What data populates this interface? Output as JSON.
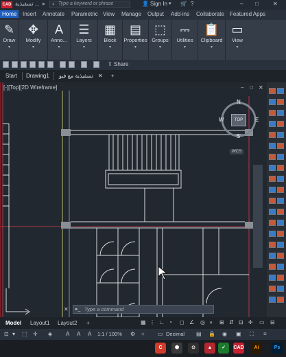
{
  "titlebar": {
    "app_logo": "CAD",
    "document_title": "تسفيذية ...",
    "search_placeholder": "Type a keyword or phrase",
    "signin_label": "Sign In",
    "window_controls": [
      "–",
      "□",
      "✕"
    ]
  },
  "menu_tabs": [
    "Home",
    "Insert",
    "Annotate",
    "Parametric",
    "View",
    "Manage",
    "Output",
    "Add-ins",
    "Collaborate",
    "Featured Apps"
  ],
  "ribbon_groups": [
    {
      "label": "Draw",
      "icon": "draw-icon"
    },
    {
      "label": "Modify",
      "icon": "modify-icon"
    },
    {
      "label": "Anno...",
      "icon": "annotation-icon"
    },
    {
      "label": "Layers",
      "icon": "layers-icon"
    },
    {
      "label": "Block",
      "icon": "block-icon"
    },
    {
      "label": "Properties",
      "icon": "properties-icon"
    },
    {
      "label": "Groups",
      "icon": "groups-icon"
    },
    {
      "label": "Utilities",
      "icon": "utilities-icon"
    },
    {
      "label": "Clipboard",
      "icon": "clipboard-icon"
    },
    {
      "label": "View",
      "icon": "view-icon"
    }
  ],
  "quick_access": {
    "share_label": "Share"
  },
  "file_tabs": {
    "start": "Start",
    "drawing1": "Drawing1",
    "active_doc": "تسفيذية مع فيو",
    "add": "+"
  },
  "viewport": {
    "label": "[-][Top][2D Wireframe]",
    "viewcube": {
      "top": "TOP",
      "north": "N",
      "south": "S",
      "east": "E",
      "west": "W"
    },
    "wcs": "WCS"
  },
  "command_line": {
    "placeholder": "Type a command"
  },
  "layout_tabs": {
    "model": "Model",
    "layout1": "Layout1",
    "layout2": "Layout2",
    "add": "+"
  },
  "statusbar": {
    "scale": "1:1 / 100%",
    "units": "Decimal"
  },
  "taskbar": {
    "apps": [
      "CAD",
      "Ai",
      "Ps"
    ]
  },
  "colors": {
    "accent": "#1f5fbf",
    "viewport_bg": "#212830",
    "drawing_lines": "#d9dde2",
    "wall_red": "#b03a48"
  }
}
